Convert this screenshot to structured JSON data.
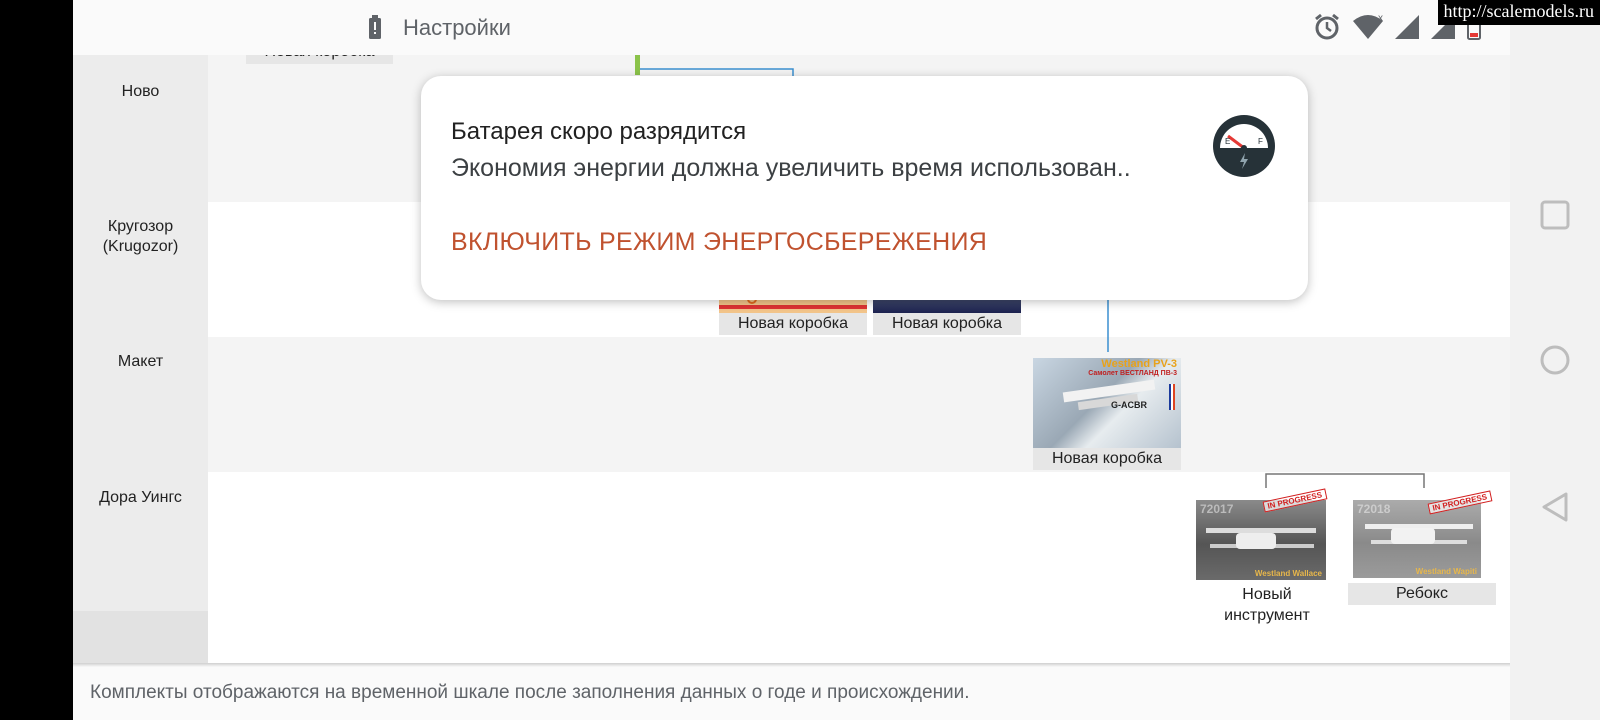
{
  "status_bar": {
    "title": "Настройки",
    "icons": [
      "battery-low-icon",
      "alarm-icon",
      "wifi-icon",
      "signal-icon",
      "signal-icon",
      "battery-icon"
    ]
  },
  "timeline": {
    "rows": [
      {
        "label": "Ново"
      },
      {
        "label": "Кругозор\n(Krugozor)"
      },
      {
        "label": "Макет"
      },
      {
        "label": "Дора Уингс"
      }
    ],
    "cards": {
      "top_partial": "Новая коробка",
      "krugozor_1": "Новая коробка",
      "krugozor_2": "Новая коробка",
      "maket_1": "Новая коробка",
      "dora_1_line1": "Новый",
      "dora_1_line2": "инструмент",
      "dora_2": "Ребокс"
    },
    "box_art_text": {
      "maket_header": "Westland PV-3",
      "maket_sub": "Самолет ВЕСТЛАНД ПВ-3",
      "maket_reg": "G-ACBR",
      "dora_1_num": "72017",
      "dora_1_name": "Westland Wallace",
      "dora_2_num": "72018",
      "dora_2_name": "Westland Wapiti",
      "in_progress": "IN PROGRESS"
    }
  },
  "footer": {
    "text": "Комплекты отображаются на временной шкале после заполнения данных о годе и происхождении."
  },
  "notification": {
    "title": "Батарея скоро разрядится",
    "body": "Экономия энергии должна увеличить время использован..",
    "action": "ВКЛЮЧИТЬ РЕЖИМ ЭНЕРГОСБЕРЕЖЕНИЯ",
    "icon": "battery-gauge-icon",
    "gauge_labels": [
      "E",
      "F"
    ]
  },
  "nav": {
    "buttons": [
      "recents-button",
      "home-button",
      "back-button"
    ]
  },
  "watermark": "http://scalemodels.ru",
  "colors": {
    "accent": "#c0522f",
    "timeline_line": "#3a8fd0",
    "marker_green": "#8bc34a",
    "stamp_red": "#d22020"
  }
}
